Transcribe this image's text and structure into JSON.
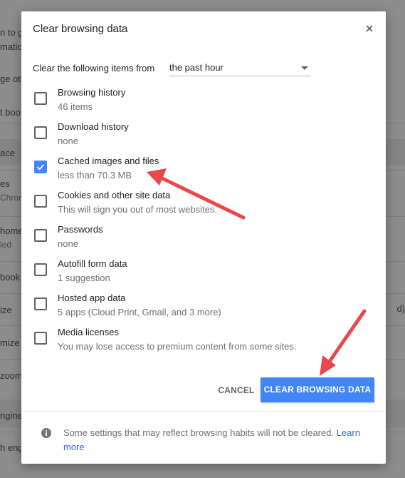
{
  "background": {
    "fragments": [
      "n to g",
      "matica",
      "ge oth",
      "t boo",
      "ace",
      "es",
      "Chron",
      "home",
      "led",
      "book",
      "ize",
      "mize",
      "zoom",
      "ngine",
      "h eng",
      "d)"
    ]
  },
  "dialog": {
    "title": "Clear browsing data",
    "close_icon": "close-icon",
    "time_range_label": "Clear the following items from",
    "time_range_value": "the past hour",
    "items": [
      {
        "label": "Browsing history",
        "sub": "46 items",
        "checked": false
      },
      {
        "label": "Download history",
        "sub": "none",
        "checked": false
      },
      {
        "label": "Cached images and files",
        "sub": "less than 70.3 MB",
        "checked": true
      },
      {
        "label": "Cookies and other site data",
        "sub": "This will sign you out of most websites.",
        "checked": false
      },
      {
        "label": "Passwords",
        "sub": "none",
        "checked": false
      },
      {
        "label": "Autofill form data",
        "sub": "1 suggestion",
        "checked": false
      },
      {
        "label": "Hosted app data",
        "sub": "5 apps (Cloud Print, Gmail, and 3 more)",
        "checked": false
      },
      {
        "label": "Media licenses",
        "sub": "You may lose access to premium content from some sites.",
        "checked": false
      }
    ],
    "cancel_label": "CANCEL",
    "confirm_label": "CLEAR BROWSING DATA",
    "footer_text": "Some settings that may reflect browsing habits will not be cleared.",
    "learn_more": "Learn more"
  },
  "colors": {
    "accent": "#4285f4",
    "arrow": "#e8474b",
    "link": "#3367d6"
  }
}
